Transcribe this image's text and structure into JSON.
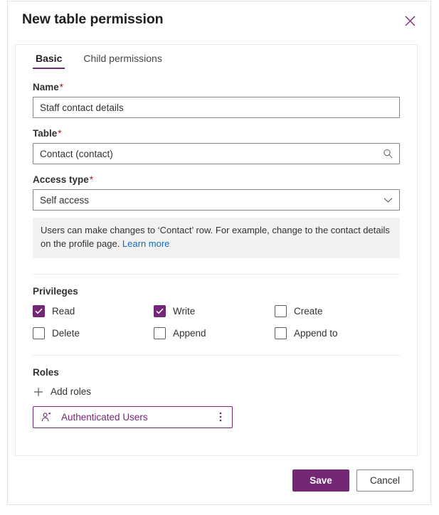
{
  "panel": {
    "title": "New table permission",
    "close_icon": "close-icon"
  },
  "tabs": [
    {
      "label": "Basic",
      "active": true
    },
    {
      "label": "Child permissions",
      "active": false
    }
  ],
  "fields": {
    "name": {
      "label": "Name",
      "required_marker": "*",
      "value": "Staff contact details",
      "placeholder": ""
    },
    "table": {
      "label": "Table",
      "required_marker": "*",
      "value": "Contact (contact)",
      "placeholder": "",
      "icon": "search-icon"
    },
    "access_type": {
      "label": "Access type",
      "required_marker": "*",
      "value": "Self access",
      "icon": "chevron-down-icon",
      "options": [
        "Self access"
      ]
    }
  },
  "info": {
    "text": "Users can make changes to ‘Contact’ row. For example, change to the contact details on the profile page. ",
    "link_label": "Learn more"
  },
  "privileges": {
    "title": "Privileges",
    "items": [
      {
        "label": "Read",
        "checked": true
      },
      {
        "label": "Write",
        "checked": true
      },
      {
        "label": "Create",
        "checked": false
      },
      {
        "label": "Delete",
        "checked": false
      },
      {
        "label": "Append",
        "checked": false
      },
      {
        "label": "Append to",
        "checked": false
      }
    ]
  },
  "roles": {
    "title": "Roles",
    "add_label": "Add roles",
    "add_icon": "plus-icon",
    "chips": [
      {
        "label": "Authenticated Users",
        "icon": "person-role-icon",
        "menu_icon": "more-vertical-icon"
      }
    ]
  },
  "footer": {
    "save_label": "Save",
    "cancel_label": "Cancel"
  },
  "colors": {
    "accent": "#742774",
    "required": "#a4262c",
    "link": "#0f6cbd",
    "info_bg": "#f3f2f1"
  }
}
